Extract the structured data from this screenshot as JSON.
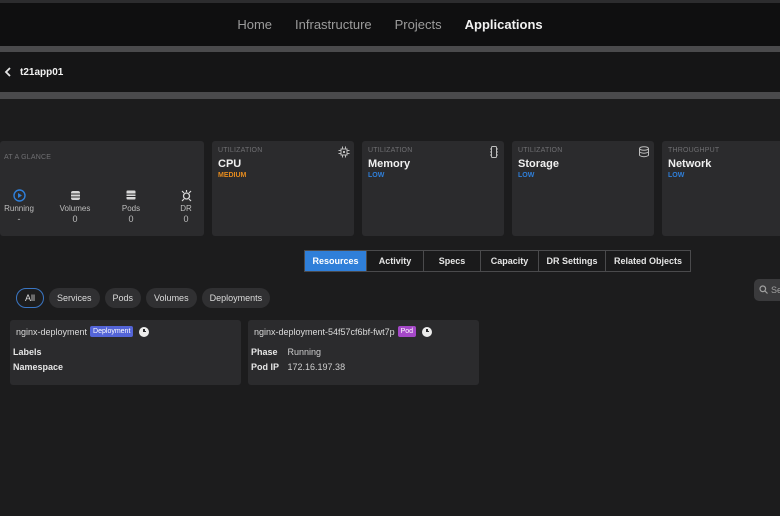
{
  "nav": {
    "items": [
      "Home",
      "Infrastructure",
      "Projects",
      "Applications"
    ],
    "active": "Applications"
  },
  "breadcrumb": {
    "title": "t21app01"
  },
  "glance": {
    "kicker": "AT A GLANCE",
    "items": [
      {
        "label": "Running",
        "value": "-",
        "icon": "play-circle-icon"
      },
      {
        "label": "Volumes",
        "value": "0",
        "icon": "database-icon"
      },
      {
        "label": "Pods",
        "value": "0",
        "icon": "pods-icon"
      },
      {
        "label": "DR",
        "value": "0",
        "icon": "dr-shield-icon"
      }
    ]
  },
  "metrics": [
    {
      "kicker": "UTILIZATION",
      "title": "CPU",
      "level": "MEDIUM",
      "level_color": "#e58b1e",
      "icon": "cpu-icon"
    },
    {
      "kicker": "UTILIZATION",
      "title": "Memory",
      "level": "LOW",
      "level_color": "#2f7fd9",
      "icon": "memory-icon"
    },
    {
      "kicker": "UTILIZATION",
      "title": "Storage",
      "level": "LOW",
      "level_color": "#2f7fd9",
      "icon": "storage-icon"
    },
    {
      "kicker": "THROUGHPUT",
      "title": "Network",
      "level": "LOW",
      "level_color": "#2f7fd9",
      "icon": "network-icon"
    }
  ],
  "tabs": [
    "Resources",
    "Activity",
    "Specs",
    "Capacity",
    "DR Settings",
    "Related Objects"
  ],
  "active_tab": "Resources",
  "search": {
    "placeholder": "Se"
  },
  "filters": [
    "All",
    "Services",
    "Pods",
    "Volumes",
    "Deployments"
  ],
  "active_filter": "All",
  "resources": [
    {
      "name": "nginx-deployment",
      "type": "Deployment",
      "fields": [
        {
          "key": "Labels",
          "value": ""
        },
        {
          "key": "Namespace",
          "value": ""
        }
      ]
    },
    {
      "name": "nginx-deployment-54f57cf6bf-fwt7p",
      "type": "Pod",
      "fields": [
        {
          "key": "Phase",
          "value": "Running"
        },
        {
          "key": "Pod IP",
          "value": "172.16.197.38"
        }
      ]
    }
  ]
}
